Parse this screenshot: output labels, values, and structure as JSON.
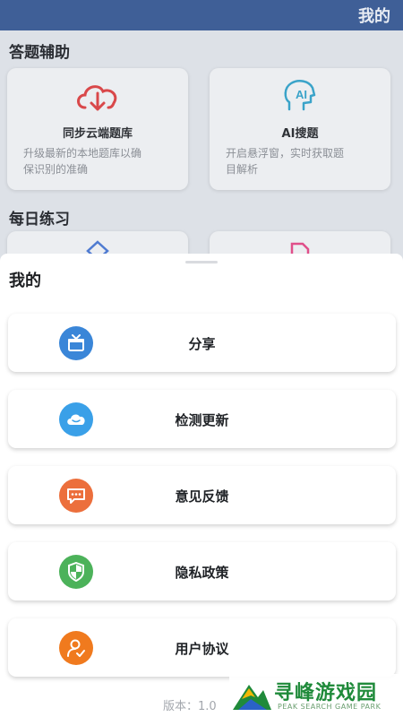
{
  "header": {
    "title": "我的"
  },
  "sections": {
    "answer_help": "答题辅助",
    "daily_practice": "每日练习"
  },
  "cards": [
    {
      "title": "同步云端题库",
      "desc_line1": "升级最新的本地题库以确",
      "desc_line2": "保识别的准确",
      "icon": "cloud-download-icon"
    },
    {
      "title": "AI搜题",
      "desc_line1": "开启悬浮窗，实时获取题",
      "desc_line2": "目解析",
      "icon": "ai-head-icon"
    }
  ],
  "sheet": {
    "title": "我的",
    "items": [
      {
        "label": "分享",
        "icon": "gift-icon",
        "color": "#3a86d8"
      },
      {
        "label": "检测更新",
        "icon": "cloud-icon",
        "color": "#3aa0e8"
      },
      {
        "label": "意见反馈",
        "icon": "chat-icon",
        "color": "#ec6f3c"
      },
      {
        "label": "隐私政策",
        "icon": "shield-icon",
        "color": "#4cb25a"
      },
      {
        "label": "用户协议",
        "icon": "user-check-icon",
        "color": "#f07a1e"
      }
    ],
    "version": "版本：1.0"
  },
  "watermark": {
    "title": "寻峰游戏园",
    "subtitle": "PEAK SEARCH GAME PARK"
  }
}
